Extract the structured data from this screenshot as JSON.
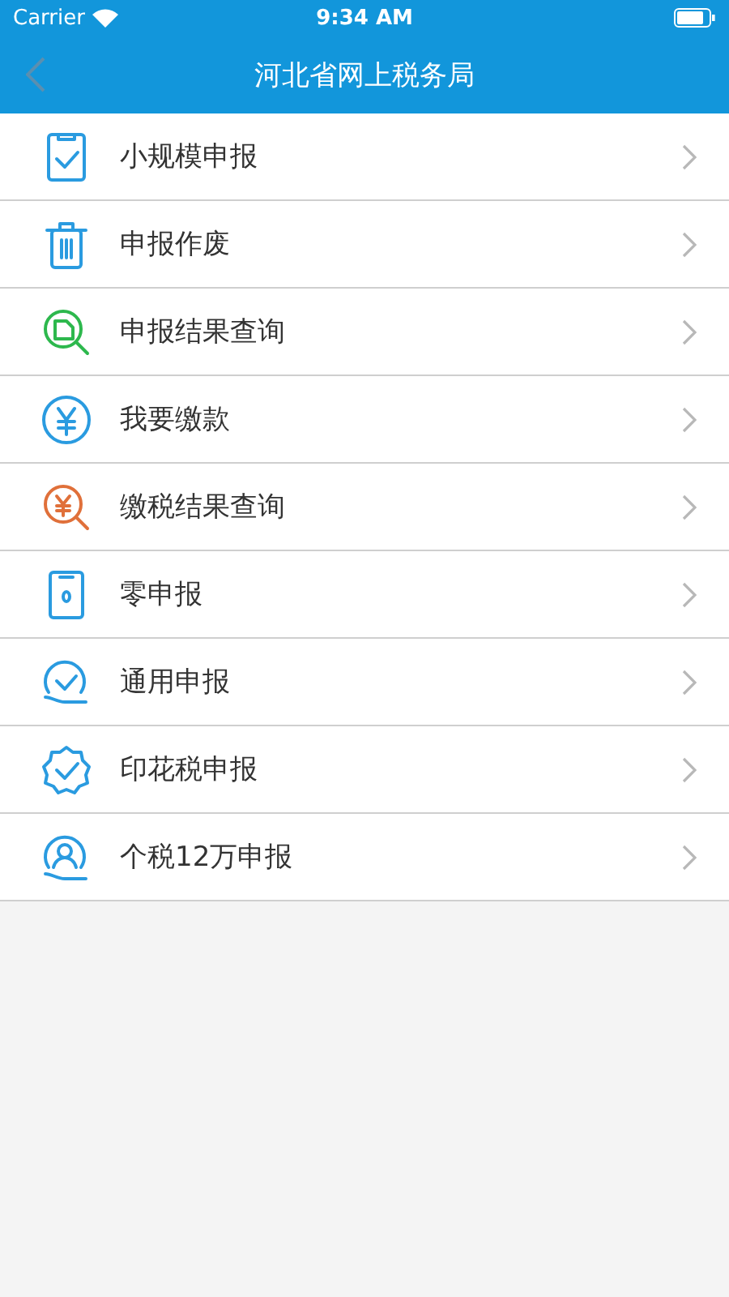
{
  "status_bar": {
    "carrier": "Carrier",
    "time": "9:34 AM"
  },
  "nav": {
    "title": "河北省网上税务局"
  },
  "menu": [
    {
      "label": "小规模申报"
    },
    {
      "label": "申报作废"
    },
    {
      "label": "申报结果查询"
    },
    {
      "label": "我要缴款"
    },
    {
      "label": "缴税结果查询"
    },
    {
      "label": "零申报"
    },
    {
      "label": "通用申报"
    },
    {
      "label": "印花税申报"
    },
    {
      "label": "个税12万申报"
    }
  ]
}
